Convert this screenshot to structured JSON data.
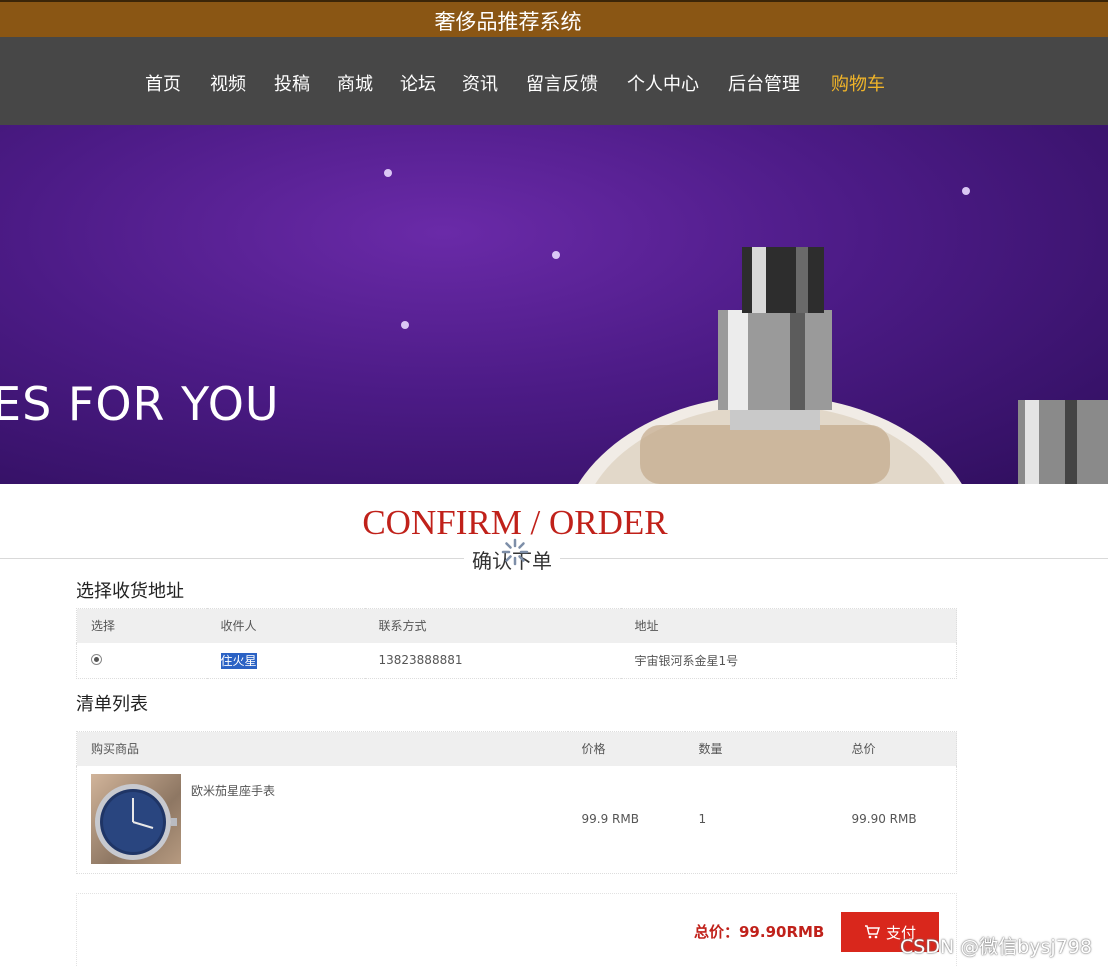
{
  "header": {
    "title": "奢侈品推荐系统"
  },
  "nav": {
    "items": [
      {
        "label": "首页"
      },
      {
        "label": "视频"
      },
      {
        "label": "投稿"
      },
      {
        "label": "商城"
      },
      {
        "label": "论坛"
      },
      {
        "label": "资讯"
      },
      {
        "label": "留言反馈"
      },
      {
        "label": "个人中心"
      },
      {
        "label": "后台管理"
      },
      {
        "label": "购物车",
        "active": true
      }
    ]
  },
  "banner": {
    "tagline": "ES FOR YOU"
  },
  "section": {
    "title_en": "CONFIRM / ORDER",
    "title_cn": "确认下单"
  },
  "address": {
    "heading": "选择收货地址",
    "columns": [
      "选择",
      "收件人",
      "联系方式",
      "地址"
    ],
    "rows": [
      {
        "selected": true,
        "recipient": "住火星",
        "phone": "13823888881",
        "address": "宇宙银河系金星1号"
      }
    ]
  },
  "order": {
    "heading": "清单列表",
    "columns": [
      "购买商品",
      "价格",
      "数量",
      "总价"
    ],
    "items": [
      {
        "name": "欧米茄星座手表",
        "price": "99.9 RMB",
        "quantity": "1",
        "total": "99.90 RMB"
      }
    ]
  },
  "summary": {
    "total_label": "总价：99.90RMB",
    "pay_label": "支付"
  },
  "watermark": "CSDN @微信bysj798",
  "colors": {
    "accent": "#c0211a",
    "nav_active": "#f0b429",
    "title_bar": "#8a5614",
    "nav_bg": "#474747",
    "pay_button": "#d9271c"
  }
}
